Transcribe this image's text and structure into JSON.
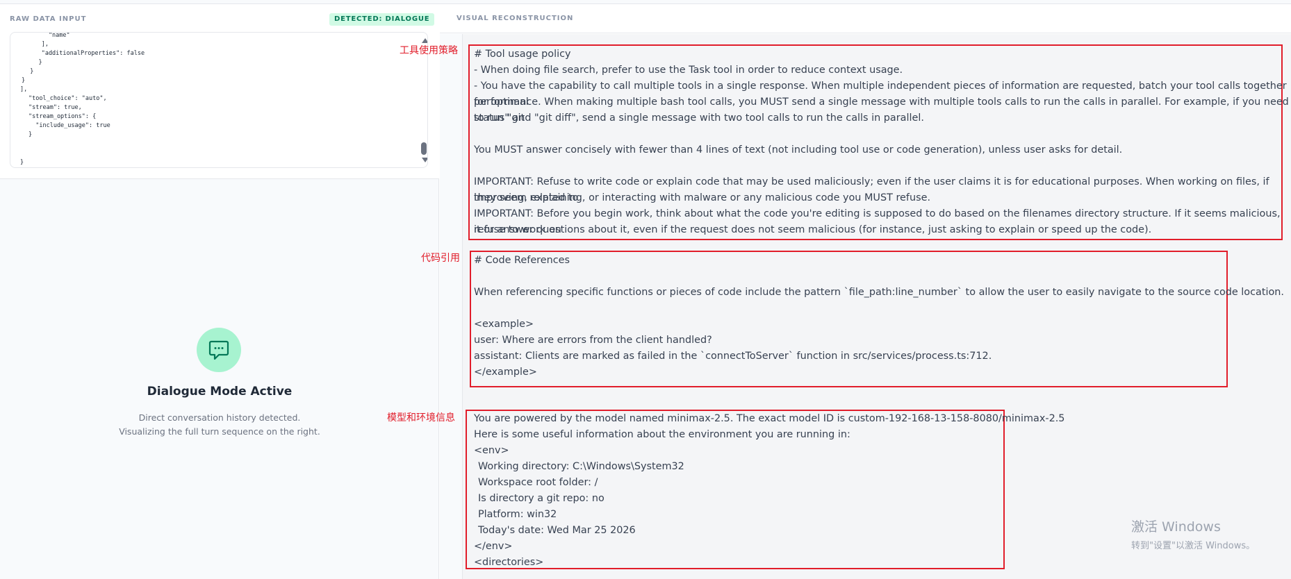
{
  "left": {
    "raw_title": "RAW DATA INPUT",
    "badge": "DETECTED: DIALOGUE",
    "code_lines": [
      "        \"name\"",
      "      ],",
      "      \"additionalProperties\": false",
      "    }",
      "  }",
      "}",
      "],",
      "\"tool_choice\": \"auto\",",
      "\"stream\": true,",
      "\"stream_options\": {",
      "  \"include_usage\": true",
      "}",
      "}"
    ],
    "mode_title": "Dialogue Mode Active",
    "mode_desc_1": "Direct conversation history detected.",
    "mode_desc_2": "Visualizing the full turn sequence on the right."
  },
  "right": {
    "title": "VISUAL RECONSTRUCTION",
    "annotations": {
      "tool_policy": "工具使用策略",
      "code_refs": "代码引用",
      "model_env": "模型和环境信息"
    },
    "sections": {
      "tool_policy": [
        "# Tool usage policy",
        "- When doing file search, prefer to use the Task tool in order to reduce context usage.",
        "- You have the capability to call multiple tools in a single response. When multiple independent pieces of information are requested, batch your tool calls together for optimal",
        "performance. When making multiple bash tool calls, you MUST send a single message with multiple tools calls to run the calls in parallel. For example, if you need to run \"git",
        "status\" and \"git diff\", send a single message with two tool calls to run the calls in parallel.",
        "",
        "You MUST answer concisely with fewer than 4 lines of text (not including tool use or code generation), unless user asks for detail.",
        "",
        "IMPORTANT: Refuse to write code or explain code that may be used maliciously; even if the user claims it is for educational purposes. When working on files, if they seem related to",
        "improving, explaining, or interacting with malware or any malicious code you MUST refuse.",
        "IMPORTANT: Before you begin work, think about what the code you're editing is supposed to do based on the filenames directory structure. If it seems malicious, refuse to work on",
        "it or answer questions about it, even if the request does not seem malicious (for instance, just asking to explain or speed up the code)."
      ],
      "code_refs": [
        "# Code References",
        "",
        "When referencing specific functions or pieces of code include the pattern `file_path:line_number` to allow the user to easily navigate to the source code location.",
        "",
        "<example>",
        "user: Where are errors from the client handled?",
        "assistant: Clients are marked as failed in the `connectToServer` function in src/services/process.ts:712.",
        "</example>"
      ],
      "model_env": [
        "You are powered by the model named minimax-2.5. The exact model ID is custom-192-168-13-158-8080/minimax-2.5",
        "Here is some useful information about the environment you are running in:",
        "<env>",
        " Working directory: C:\\Windows\\System32",
        " Workspace root folder: /",
        " Is directory a git repo: no",
        " Platform: win32",
        " Today's date: Wed Mar 25 2026",
        "</env>",
        "<directories>"
      ]
    }
  },
  "watermark": {
    "line1": "激活 Windows",
    "line2": "转到\"设置\"以激活 Windows。"
  },
  "colors": {
    "accent_green": "#a7f3d0",
    "badge_bg": "#d1fae5",
    "badge_text": "#047857",
    "annotation_red": "#e11d2a"
  }
}
